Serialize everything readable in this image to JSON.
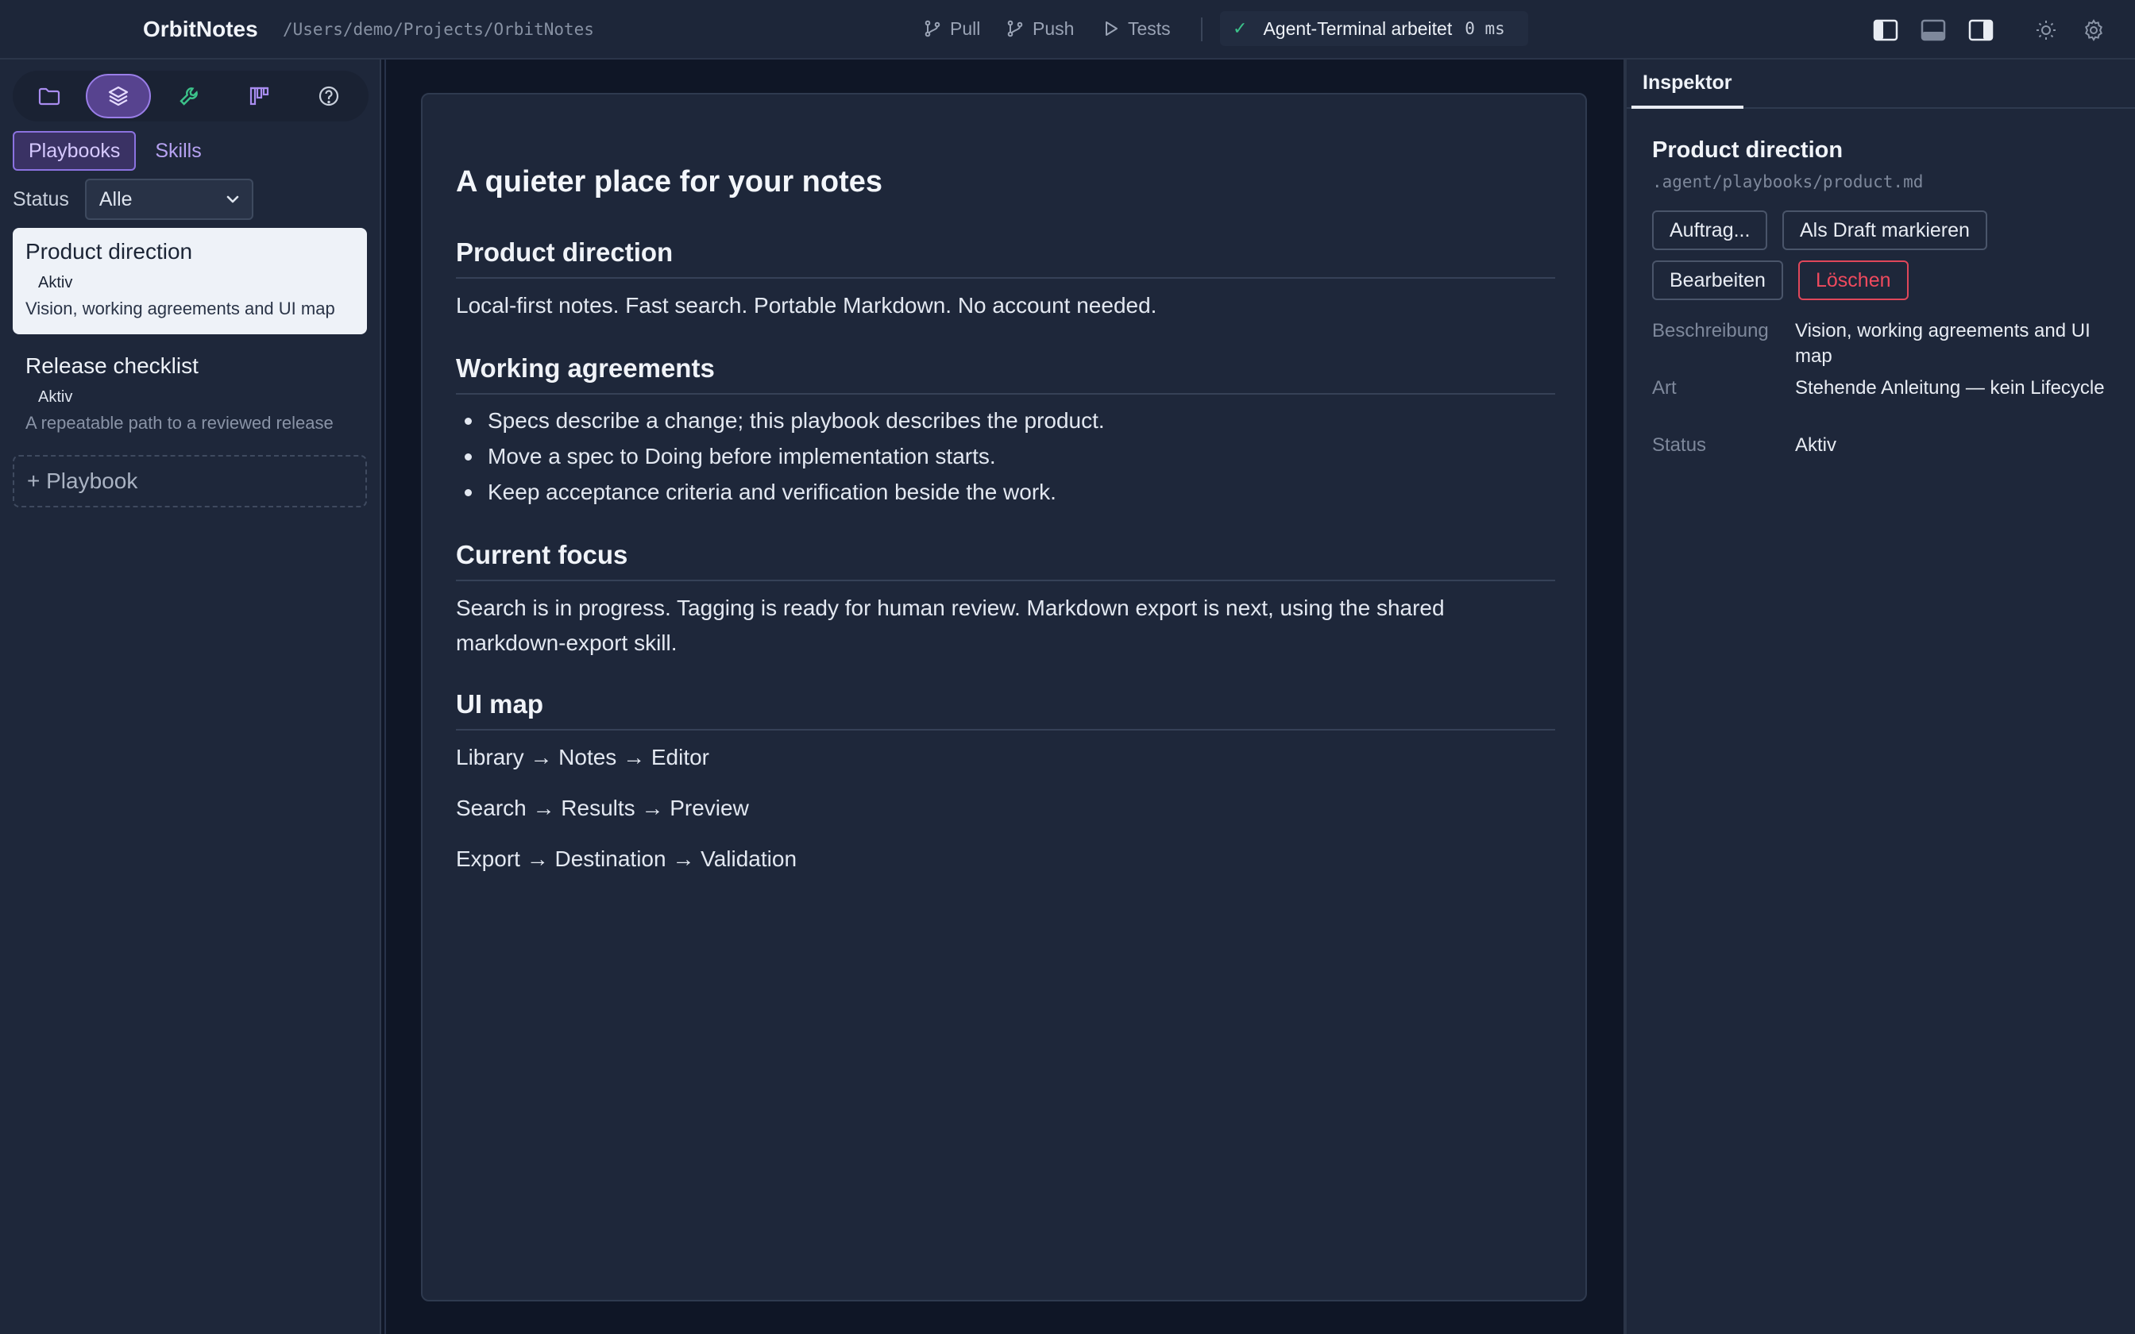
{
  "app": {
    "title": "OrbitNotes",
    "path": "/Users/demo/Projects/OrbitNotes"
  },
  "toolbar": {
    "pull_label": "Pull",
    "push_label": "Push",
    "tests_label": "Tests",
    "agent_status": "Agent-Terminal arbeitet",
    "agent_time": "0 ms"
  },
  "sidebar": {
    "tabs": [
      {
        "label": "Playbooks"
      },
      {
        "label": "Skills"
      }
    ],
    "status_filter": {
      "label": "Status",
      "value": "Alle"
    },
    "items": [
      {
        "title": "Product direction",
        "status": "Aktiv",
        "description": "Vision, working agreements and UI map"
      },
      {
        "title": "Release checklist",
        "status": "Aktiv",
        "description": "A repeatable path to a reviewed release"
      }
    ],
    "add_label": "+ Playbook"
  },
  "document": {
    "title": "A quieter place for your notes",
    "sections": {
      "product_direction": {
        "heading": "Product direction",
        "text": "Local-first notes. Fast search. Portable Markdown. No account needed."
      },
      "working_agreements": {
        "heading": "Working agreements",
        "items": [
          "Specs describe a change; this playbook describes the product.",
          "Move a spec to Doing before implementation starts.",
          "Keep acceptance criteria and verification beside the work."
        ]
      },
      "current_focus": {
        "heading": "Current focus",
        "text": "Search is in progress. Tagging is ready for human review. Markdown export is next, using the shared markdown-export skill."
      },
      "ui_map": {
        "heading": "UI map",
        "lines": [
          "Library → Notes → Editor",
          "Search → Results → Preview",
          "Export → Destination → Validation"
        ]
      }
    }
  },
  "inspector": {
    "tab_label": "Inspektor",
    "title": "Product direction",
    "path": ".agent/playbooks/product.md",
    "buttons": {
      "assign": "Auftrag...",
      "draft": "Als Draft markieren",
      "edit": "Bearbeiten",
      "delete": "Löschen"
    },
    "meta": {
      "description_label": "Beschreibung",
      "description_value": "Vision, working agreements and UI map",
      "kind_label": "Art",
      "kind_value": "Stehende Anleitung — kein Lifecycle",
      "status_label": "Status",
      "status_value": "Aktiv"
    }
  },
  "colors": {
    "accent": "#8b72e0",
    "success": "#3cc28a",
    "danger": "#f04a5e",
    "surface": "#1e273a",
    "background": "#0f1626"
  },
  "icons": [
    "git-branch-icon",
    "git-push-icon",
    "play-icon",
    "check-icon",
    "layout-sidebar-left-icon",
    "layout-bottom-panel-icon",
    "layout-sidebar-right-icon",
    "sun-icon",
    "gear-icon",
    "folder-icon",
    "layers-icon",
    "wrench-icon",
    "kanban-icon",
    "help-icon",
    "chevron-down-icon"
  ]
}
